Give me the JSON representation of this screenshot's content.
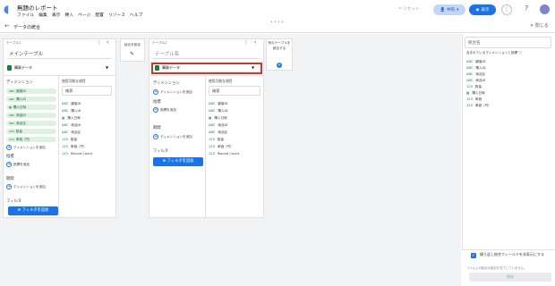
{
  "app": {
    "title": "無題のレポート",
    "menu": [
      "ファイル",
      "編集",
      "表示",
      "挿入",
      "ページ",
      "配置",
      "リソース",
      "ヘルプ"
    ],
    "undo_label": "リセット",
    "share_label": "共有",
    "view_label": "表示"
  },
  "subheader": {
    "title": "データの統合",
    "close_label": "閉じる"
  },
  "table1": {
    "label": "テーブル1",
    "name": "メインテーブル",
    "datasource": "購買データ",
    "dims_heading": "ディメンション",
    "dims": [
      "顧客ID",
      "購入ID",
      "購入日時",
      "商品ID",
      "商品名",
      "数量",
      "単価（円）"
    ],
    "add_dim": "ディメンションを追加",
    "metrics_heading": "指標",
    "add_metric": "指標を追加",
    "period_heading": "期間",
    "add_period": "ディメンションを追加",
    "filter_heading": "フィルタ",
    "filter_btn": "フィルタを追加",
    "available_heading": "使用可能な項目",
    "search_placeholder": "検索",
    "fields": [
      "顧客ID",
      "購入ID",
      "購入日時",
      "商品ID",
      "商品名",
      "数量",
      "単価（円）",
      "Record Count"
    ]
  },
  "join": {
    "label": "結合を設定"
  },
  "table2": {
    "label": "テーブル2",
    "name_placeholder": "テーブル名",
    "datasource": "購買データ",
    "dims_heading": "ディメンション",
    "add_dim": "ディメンションを追加",
    "metrics_heading": "指標",
    "add_metric": "指標を追加",
    "period_heading": "期間",
    "add_period": "ディメンションを追加",
    "filter_heading": "フィルタ",
    "filter_btn": "フィルタを追加",
    "available_heading": "使用可能な項目",
    "search_placeholder": "検索",
    "fields": [
      "顧客ID",
      "購入ID",
      "購入日時",
      "商品ID",
      "商品名",
      "数量",
      "単価（円）",
      "Record Count"
    ]
  },
  "add_table": {
    "label": "別のテーブルを統合する"
  },
  "right_panel": {
    "name_placeholder": "統合名",
    "included_heading": "含まれているディメンションと指標",
    "fields": [
      "顧客ID",
      "購入ID",
      "商品名",
      "商品ID",
      "数量",
      "購入日時",
      "単価",
      "単価（円）"
    ],
    "checkbox_label": "繰り返し統合フィールドを非表示にする",
    "note": "1つ以上の統合の設定を完了していません。",
    "apply_label": "保存"
  }
}
